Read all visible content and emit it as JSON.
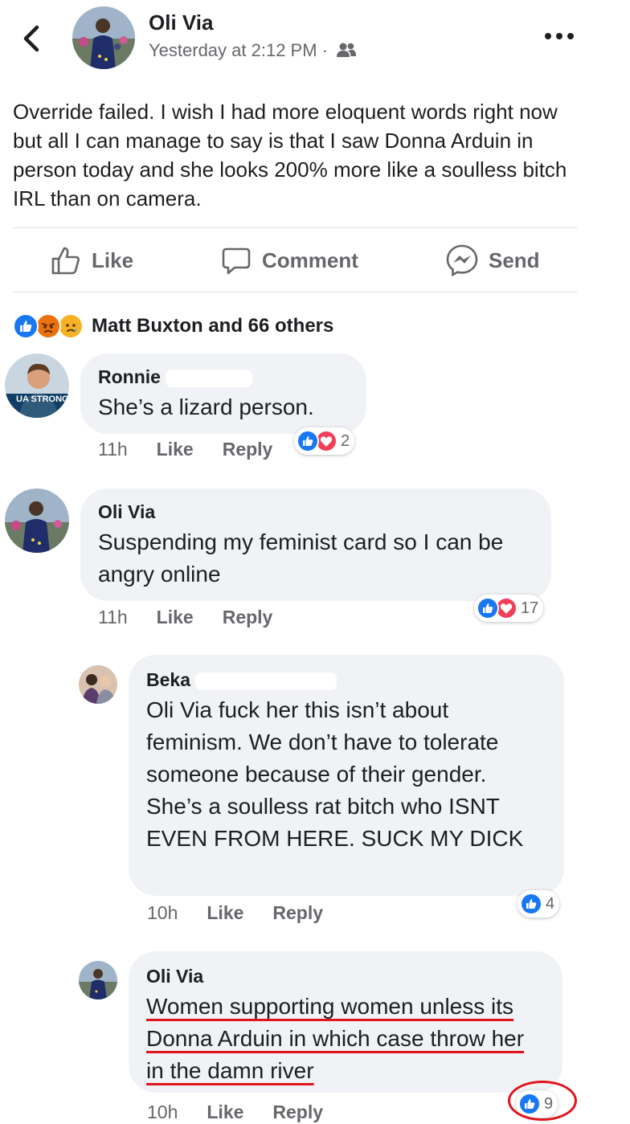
{
  "post": {
    "author": "Oli Via",
    "timestamp": "Yesterday at 2:12 PM ·",
    "audience_icon": "friends-icon",
    "text": "Override failed. I wish I had more eloquent words right now but all I can manage to say is that I saw Donna Arduin in person today and she looks 200% more like a soulless bitch IRL than on camera."
  },
  "actions": {
    "like": "Like",
    "comment": "Comment",
    "send": "Send"
  },
  "reactions_summary": {
    "icons": [
      "like-icon",
      "angry-icon",
      "sad-icon"
    ],
    "text": "Matt Buxton and 66 others"
  },
  "comments": [
    {
      "name": "Ronnie",
      "text": "She’s a lizard person.",
      "time": "11h",
      "like": "Like",
      "reply": "Reply",
      "reactions": [
        "like-icon",
        "love-icon"
      ],
      "count": "2"
    },
    {
      "name": "Oli Via",
      "text": "Suspending my feminist card so I can be angry online",
      "time": "11h",
      "like": "Like",
      "reply": "Reply",
      "reactions": [
        "like-icon",
        "love-icon"
      ],
      "count": "17"
    }
  ],
  "replies": [
    {
      "name": "Beka",
      "text": "Oli Via fuck her this isn’t about feminism. We don’t have to tolerate someone because of their gender. She’s a soulless rat bitch who ISNT EVEN FROM HERE. SUCK MY DICK",
      "time": "10h",
      "like": "Like",
      "reply": "Reply",
      "reactions": [
        "like-icon"
      ],
      "count": "4"
    },
    {
      "name": "Oli Via",
      "text": "Women supporting women unless its Donna Arduin in which case throw her in the damn river",
      "time": "10h",
      "like": "Like",
      "reply": "Reply",
      "reactions": [
        "like-icon"
      ],
      "count": "9"
    }
  ],
  "avatar_badge": "UA STRONG",
  "colors": {
    "like_blue": "#1877f2",
    "love_red": "#f33e58",
    "angry_orange": "#e9710f",
    "sad_yellow": "#f7b125",
    "annotation_red": "#e0141e",
    "bubble_gray": "#f0f2f5",
    "meta_gray": "#65676b"
  }
}
